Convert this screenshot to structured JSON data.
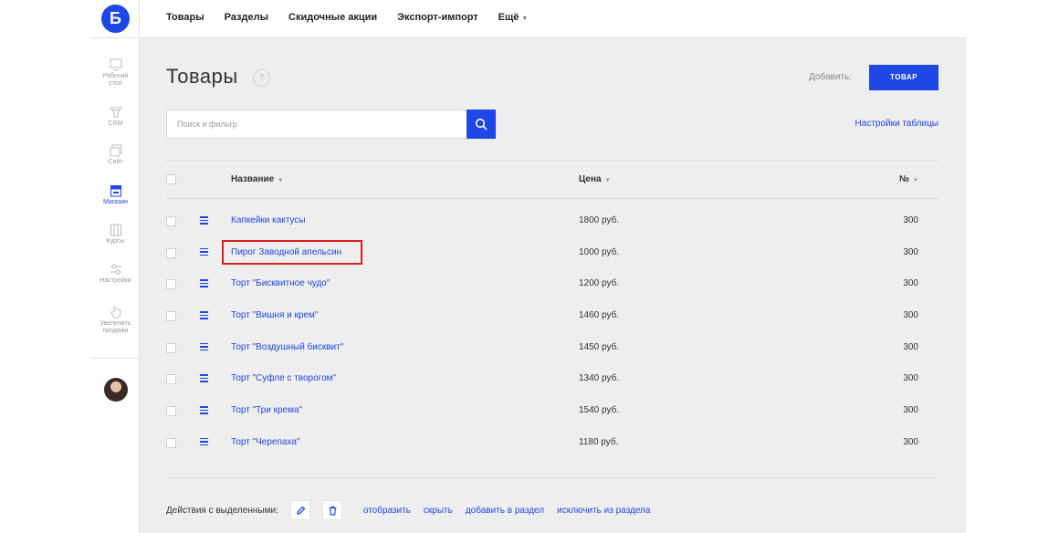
{
  "logo": {
    "letter": "Б"
  },
  "sidebar": {
    "items": [
      {
        "label": "Рабочий\nстол",
        "icon": "desktop-icon",
        "active": false
      },
      {
        "label": "CRM",
        "icon": "crm-funnel-icon",
        "active": false
      },
      {
        "label": "Сайт",
        "icon": "site-pages-icon",
        "active": false
      },
      {
        "label": "Магазин",
        "icon": "shop-icon",
        "active": true
      },
      {
        "label": "Курсы",
        "icon": "courses-icon",
        "active": false
      },
      {
        "label": "Настройки",
        "icon": "settings-sliders-icon",
        "active": false
      },
      {
        "label": "Увеличить\nпродажи",
        "icon": "hand-pointer-icon",
        "active": false
      }
    ]
  },
  "topnav": {
    "items": [
      "Товары",
      "Разделы",
      "Скидочные акции",
      "Экспорт-импорт",
      "Ещё"
    ]
  },
  "page": {
    "title": "Товары",
    "help": "?",
    "add_label": "Добавить:",
    "add_button": "ТОВАР",
    "table_settings": "Настройки таблицы"
  },
  "search": {
    "placeholder": "Поиск и фильтр",
    "value": ""
  },
  "table": {
    "columns": {
      "name": "Название",
      "price": "Цена",
      "num": "№"
    },
    "rows": [
      {
        "name": "Капкейки кактусы",
        "price": "1800 руб.",
        "num": "300",
        "highlighted": false
      },
      {
        "name": "Пирог Заводной апельсин",
        "price": "1000 руб.",
        "num": "300",
        "highlighted": true
      },
      {
        "name": "Торт \"Бисквитное чудо\"",
        "price": "1200 руб.",
        "num": "300",
        "highlighted": false
      },
      {
        "name": "Торт \"Вишня и крем\"",
        "price": "1460 руб.",
        "num": "300",
        "highlighted": false
      },
      {
        "name": "Торт \"Воздушный бисквит\"",
        "price": "1450 руб.",
        "num": "300",
        "highlighted": false
      },
      {
        "name": "Торт \"Суфле с творогом\"",
        "price": "1340 руб.",
        "num": "300",
        "highlighted": false
      },
      {
        "name": "Торт \"Три крема\"",
        "price": "1540 руб.",
        "num": "300",
        "highlighted": false
      },
      {
        "name": "Торт \"Черепаха\"",
        "price": "1180 руб.",
        "num": "300",
        "highlighted": false
      }
    ]
  },
  "actions": {
    "label": "Действия с выделенными:",
    "links": [
      "отобразить",
      "скрыть",
      "добавить в раздел",
      "исключить из раздела"
    ]
  },
  "colors": {
    "accent": "#1f47e6",
    "highlight": "#e11d1d",
    "background": "#eeeeee"
  }
}
